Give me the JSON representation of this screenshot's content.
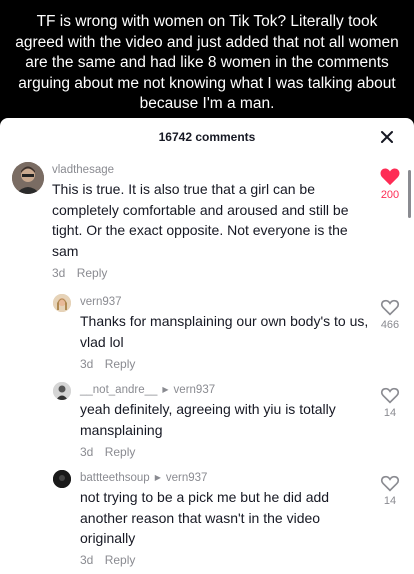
{
  "caption": "TF is wrong with women on Tik Tok? Literally took agreed with the video and just added that not all women are the same and had like 8 women in the comments arguing about me not knowing what I was talking about because I'm a man.",
  "sheet": {
    "title": "16742 comments",
    "close_icon": "close-icon"
  },
  "colors": {
    "like_active": "#fe2c55",
    "muted": "#8a8b91",
    "text": "#161823"
  },
  "comments": [
    {
      "username": "vladthesage",
      "reply_to": "",
      "text": "This is true. It is also true that a girl can be completely comfortable and aroused and still be tight. Or the exact opposite. Not everyone is the sam",
      "age": "3d",
      "reply_label": "Reply",
      "likes": "200",
      "liked": true
    },
    {
      "username": "vern937",
      "reply_to": "",
      "text": "Thanks for mansplaining our own body's to us, vlad lol",
      "age": "3d",
      "reply_label": "Reply",
      "likes": "466",
      "liked": false
    },
    {
      "username": "__not_andre__",
      "reply_to": "vern937",
      "text": "yeah definitely, agreeing with yiu is totally mansplaining",
      "age": "3d",
      "reply_label": "Reply",
      "likes": "14",
      "liked": false
    },
    {
      "username": "battteethsoup",
      "reply_to": "vern937",
      "text": "not trying to be a pick me but he did add another reason that wasn't in the video originally",
      "age": "3d",
      "reply_label": "Reply",
      "likes": "14",
      "liked": false
    }
  ]
}
